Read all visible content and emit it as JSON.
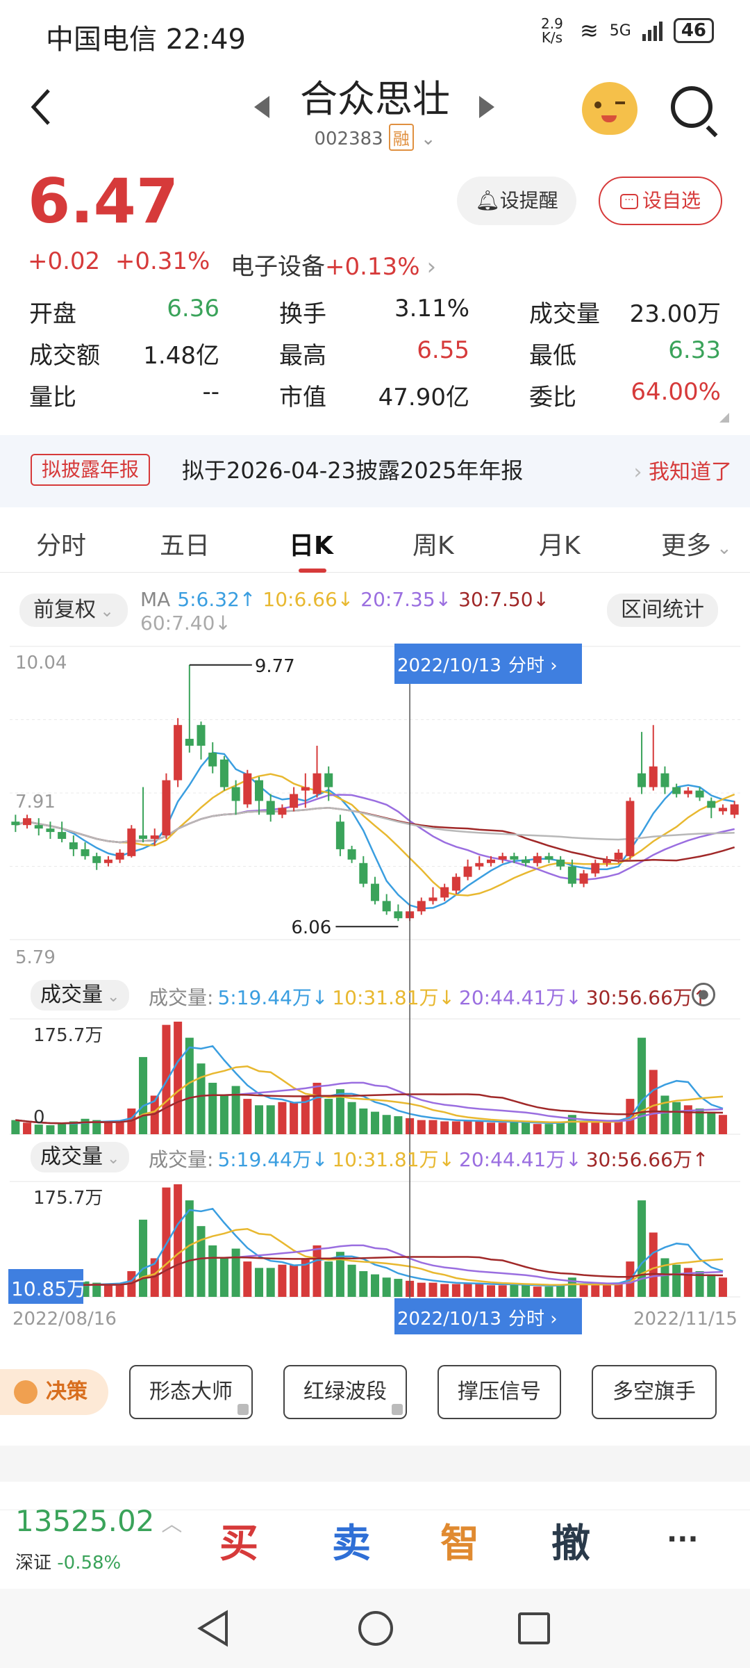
{
  "status_bar": {
    "carrier": "中国电信",
    "time": "22:49",
    "net_speed": "2.9 K/s",
    "network": "5G",
    "battery": "46"
  },
  "header": {
    "title": "合众思壮",
    "code": "002383",
    "badge": "融"
  },
  "quote": {
    "price": "6.47",
    "change": "+0.02",
    "change_pct": "+0.31%",
    "sector": "电子设备",
    "sector_change": "+0.13%",
    "remind_label": "设提醒",
    "watch_label": "设自选",
    "stats": [
      {
        "label": "开盘",
        "value": "6.36",
        "tone": "green"
      },
      {
        "label": "换手",
        "value": "3.11%",
        "tone": "neutral"
      },
      {
        "label": "成交量",
        "value": "23.00万",
        "tone": "neutral"
      },
      {
        "label": "成交额",
        "value": "1.48亿",
        "tone": "neutral"
      },
      {
        "label": "最高",
        "value": "6.55",
        "tone": "red"
      },
      {
        "label": "最低",
        "value": "6.33",
        "tone": "green"
      },
      {
        "label": "量比",
        "value": "--",
        "tone": "neutral"
      },
      {
        "label": "市值",
        "value": "47.90亿",
        "tone": "neutral"
      },
      {
        "label": "委比",
        "value": "64.00%",
        "tone": "red"
      }
    ]
  },
  "notice": {
    "tag": "拟披露年报",
    "text": "拟于2026-04-23披露2025年年报",
    "ack": "我知道了"
  },
  "tabs": [
    "分时",
    "五日",
    "日K",
    "周K",
    "月K",
    "更多"
  ],
  "active_tab": "日K",
  "kline": {
    "adjust": "前复权",
    "interval_stats": "区间统计",
    "ma": [
      {
        "label": "MA",
        "value": "",
        "color": "#888888"
      },
      {
        "label": "5:",
        "value": "6.32↑",
        "color": "#3a9ee0"
      },
      {
        "label": "10:",
        "value": "6.66↓",
        "color": "#e8b830"
      },
      {
        "label": "20:",
        "value": "7.35↓",
        "color": "#9a6ee0"
      },
      {
        "label": "30:",
        "value": "7.50↓",
        "color": "#a02828"
      },
      {
        "label": "60:",
        "value": "7.40↓",
        "color": "#aaaaaa"
      }
    ],
    "price_top": "10.04",
    "price_mid": "7.91",
    "price_bottom": "5.79",
    "high_marker": "9.77",
    "low_marker": "6.06",
    "cursor_date": "2022/10/13",
    "cursor_link": "分时",
    "start_date": "2022/08/16",
    "end_date": "2022/11/15",
    "vol_panel1": {
      "selector": "成交量",
      "prefix": "成交量:",
      "items": [
        {
          "text": "5:19.44万↓",
          "color": "#3a9ee0"
        },
        {
          "text": "10:31.81万↓",
          "color": "#e8b830"
        },
        {
          "text": "20:44.41万↓",
          "color": "#9a6ee0"
        },
        {
          "text": "30:56.66万↑",
          "color": "#a02828"
        }
      ],
      "max_label": "175.7万",
      "zero_label": "0"
    },
    "vol_panel2": {
      "selector": "成交量",
      "prefix": "成交量:",
      "items": [
        {
          "text": "5:19.44万↓",
          "color": "#3a9ee0"
        },
        {
          "text": "10:31.81万↓",
          "color": "#e8b830"
        },
        {
          "text": "20:44.41万↓",
          "color": "#9a6ee0"
        },
        {
          "text": "30:56.66万↑",
          "color": "#a02828"
        }
      ],
      "max_label": "175.7万",
      "cursor_value": "10.85万"
    }
  },
  "chart_data": {
    "type": "candlestick",
    "x_range": [
      "2022/08/16",
      "2022/11/15"
    ],
    "ylim": [
      5.79,
      10.04
    ],
    "high_label": 9.77,
    "low_label": 6.06,
    "candles": [
      {
        "o": 7.5,
        "c": 7.45,
        "h": 7.6,
        "l": 7.35
      },
      {
        "o": 7.45,
        "c": 7.55,
        "h": 7.6,
        "l": 7.4
      },
      {
        "o": 7.45,
        "c": 7.4,
        "h": 7.55,
        "l": 7.3
      },
      {
        "o": 7.4,
        "c": 7.35,
        "h": 7.5,
        "l": 7.25
      },
      {
        "o": 7.35,
        "c": 7.25,
        "h": 7.5,
        "l": 7.2
      },
      {
        "o": 7.2,
        "c": 7.1,
        "h": 7.3,
        "l": 7.0
      },
      {
        "o": 7.1,
        "c": 7.0,
        "h": 7.2,
        "l": 6.95
      },
      {
        "o": 7.0,
        "c": 6.9,
        "h": 7.05,
        "l": 6.8
      },
      {
        "o": 6.9,
        "c": 6.95,
        "h": 7.0,
        "l": 6.85
      },
      {
        "o": 6.95,
        "c": 7.05,
        "h": 7.1,
        "l": 6.9
      },
      {
        "o": 7.0,
        "c": 7.4,
        "h": 7.45,
        "l": 6.98
      },
      {
        "o": 7.3,
        "c": 7.25,
        "h": 8.0,
        "l": 7.2
      },
      {
        "o": 7.25,
        "c": 7.3,
        "h": 7.4,
        "l": 7.15
      },
      {
        "o": 7.3,
        "c": 8.1,
        "h": 8.2,
        "l": 7.25
      },
      {
        "o": 8.1,
        "c": 8.9,
        "h": 9.0,
        "l": 8.0
      },
      {
        "o": 8.7,
        "c": 8.6,
        "h": 9.77,
        "l": 8.5
      },
      {
        "o": 8.9,
        "c": 8.6,
        "h": 8.95,
        "l": 8.4
      },
      {
        "o": 8.5,
        "c": 8.3,
        "h": 8.65,
        "l": 8.2
      },
      {
        "o": 8.4,
        "c": 8.0,
        "h": 8.45,
        "l": 7.95
      },
      {
        "o": 8.0,
        "c": 7.8,
        "h": 8.1,
        "l": 7.6
      },
      {
        "o": 7.75,
        "c": 8.2,
        "h": 8.25,
        "l": 7.7
      },
      {
        "o": 8.1,
        "c": 7.8,
        "h": 8.15,
        "l": 7.6
      },
      {
        "o": 7.8,
        "c": 7.6,
        "h": 7.9,
        "l": 7.5
      },
      {
        "o": 7.6,
        "c": 7.7,
        "h": 7.75,
        "l": 7.55
      },
      {
        "o": 7.7,
        "c": 7.9,
        "h": 8.0,
        "l": 7.65
      },
      {
        "o": 7.95,
        "c": 8.0,
        "h": 8.2,
        "l": 7.7
      },
      {
        "o": 7.9,
        "c": 8.2,
        "h": 8.6,
        "l": 7.85
      },
      {
        "o": 8.2,
        "c": 8.0,
        "h": 8.3,
        "l": 7.8
      },
      {
        "o": 7.5,
        "c": 7.1,
        "h": 7.6,
        "l": 7.0
      },
      {
        "o": 7.1,
        "c": 6.95,
        "h": 7.15,
        "l": 6.9
      },
      {
        "o": 6.9,
        "c": 6.6,
        "h": 7.0,
        "l": 6.55
      },
      {
        "o": 6.6,
        "c": 6.35,
        "h": 6.7,
        "l": 6.3
      },
      {
        "o": 6.35,
        "c": 6.2,
        "h": 6.45,
        "l": 6.15
      },
      {
        "o": 6.2,
        "c": 6.1,
        "h": 6.3,
        "l": 6.06
      },
      {
        "o": 6.1,
        "c": 6.2,
        "h": 6.3,
        "l": 6.06
      },
      {
        "o": 6.2,
        "c": 6.35,
        "h": 6.4,
        "l": 6.15
      },
      {
        "o": 6.35,
        "c": 6.4,
        "h": 6.55,
        "l": 6.3
      },
      {
        "o": 6.4,
        "c": 6.55,
        "h": 6.6,
        "l": 6.35
      },
      {
        "o": 6.5,
        "c": 6.7,
        "h": 6.75,
        "l": 6.45
      },
      {
        "o": 6.7,
        "c": 6.85,
        "h": 6.95,
        "l": 6.65
      },
      {
        "o": 6.85,
        "c": 6.9,
        "h": 7.0,
        "l": 6.8
      },
      {
        "o": 6.9,
        "c": 6.95,
        "h": 7.0,
        "l": 6.85
      },
      {
        "o": 6.95,
        "c": 7.0,
        "h": 7.05,
        "l": 6.9
      },
      {
        "o": 7.0,
        "c": 6.95,
        "h": 7.05,
        "l": 6.9
      },
      {
        "o": 6.95,
        "c": 6.9,
        "h": 7.0,
        "l": 6.85
      },
      {
        "o": 6.9,
        "c": 7.0,
        "h": 7.05,
        "l": 6.85
      },
      {
        "o": 7.0,
        "c": 6.95,
        "h": 7.05,
        "l": 6.9
      },
      {
        "o": 6.95,
        "c": 6.85,
        "h": 7.0,
        "l": 6.8
      },
      {
        "o": 6.85,
        "c": 6.6,
        "h": 6.95,
        "l": 6.55
      },
      {
        "o": 6.6,
        "c": 6.75,
        "h": 6.8,
        "l": 6.55
      },
      {
        "o": 6.75,
        "c": 6.9,
        "h": 6.95,
        "l": 6.7
      },
      {
        "o": 6.9,
        "c": 6.95,
        "h": 7.0,
        "l": 6.85
      },
      {
        "o": 6.95,
        "c": 7.05,
        "h": 7.1,
        "l": 6.9
      },
      {
        "o": 7.0,
        "c": 7.8,
        "h": 7.85,
        "l": 6.95
      },
      {
        "o": 8.2,
        "c": 8.0,
        "h": 8.8,
        "l": 7.9
      },
      {
        "o": 8.0,
        "c": 8.3,
        "h": 8.9,
        "l": 7.95
      },
      {
        "o": 8.2,
        "c": 8.0,
        "h": 8.3,
        "l": 7.9
      },
      {
        "o": 8.0,
        "c": 7.9,
        "h": 8.05,
        "l": 7.85
      },
      {
        "o": 7.9,
        "c": 7.95,
        "h": 8.0,
        "l": 7.85
      },
      {
        "o": 7.95,
        "c": 7.85,
        "h": 8.0,
        "l": 7.8
      },
      {
        "o": 7.8,
        "c": 7.7,
        "h": 7.85,
        "l": 7.55
      },
      {
        "o": 7.65,
        "c": 7.7,
        "h": 7.75,
        "l": 7.6
      },
      {
        "o": 7.6,
        "c": 7.75,
        "h": 7.8,
        "l": 7.55
      }
    ],
    "volumes": [
      22,
      18,
      15,
      14,
      16,
      20,
      24,
      22,
      18,
      20,
      40,
      120,
      60,
      170,
      175,
      150,
      110,
      80,
      60,
      75,
      55,
      45,
      45,
      50,
      50,
      60,
      80,
      55,
      70,
      50,
      40,
      35,
      30,
      28,
      25,
      22,
      22,
      20,
      20,
      22,
      20,
      18,
      18,
      20,
      18,
      16,
      16,
      18,
      30,
      20,
      18,
      18,
      20,
      55,
      150,
      100,
      60,
      50,
      45,
      40,
      35,
      30
    ]
  },
  "decision_bar": {
    "decision": "决策",
    "buttons": [
      "形态大师",
      "红绿波段",
      "撑压信号",
      "多空旗手"
    ]
  },
  "footer": {
    "index_value": "13525.02",
    "index_name": "深证",
    "index_change": "-0.58%",
    "actions": [
      "买",
      "卖",
      "智",
      "撤",
      "···"
    ]
  }
}
